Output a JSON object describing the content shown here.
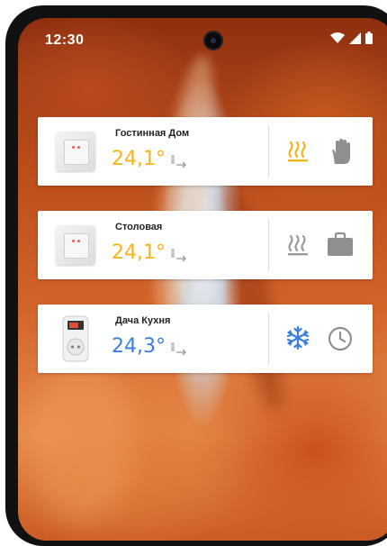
{
  "status_bar": {
    "time": "12:30"
  },
  "devices": [
    {
      "name": "Гостинная Дом",
      "temperature": "24,1°",
      "temp_color": "#f4b51c",
      "mode_icon": "heating-icon",
      "mode_active": true,
      "schedule_icon": "manual-hand-icon"
    },
    {
      "name": "Столовая",
      "temperature": "24,1°",
      "temp_color": "#f4b51c",
      "mode_icon": "heating-icon",
      "mode_active": false,
      "schedule_icon": "away-briefcase-icon"
    },
    {
      "name": "Дача Кухня",
      "temperature": "24,3°",
      "temp_color": "#3a7fe0",
      "mode_icon": "cooling-snowflake-icon",
      "mode_active": true,
      "schedule_icon": "schedule-clock-icon"
    }
  ]
}
